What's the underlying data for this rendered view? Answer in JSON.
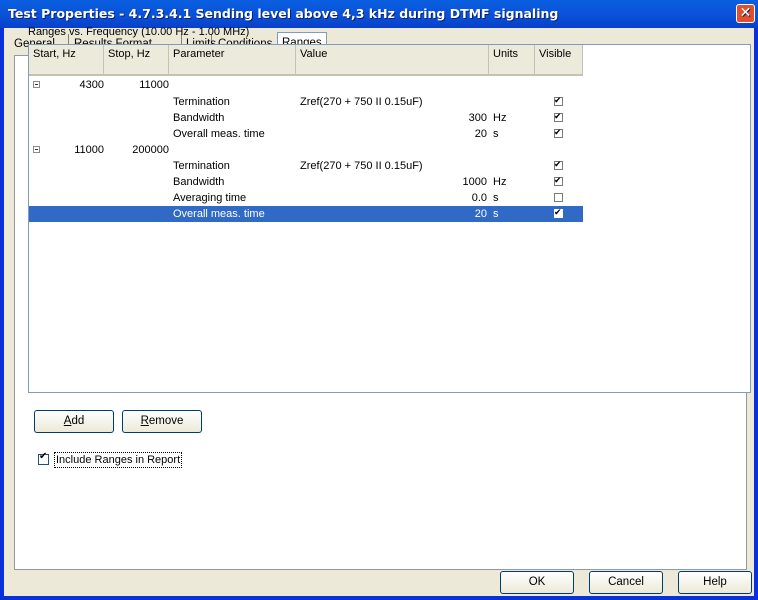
{
  "window": {
    "title": "Test Properties - 4.7.3.4.1 Sending level above 4,3 kHz during DTMF signaling",
    "close_glyph": "✕"
  },
  "tabs": [
    {
      "label": "General"
    },
    {
      "label": "Results Format"
    },
    {
      "label": "Limits"
    },
    {
      "label": "Conditions"
    },
    {
      "label": "Ranges",
      "active": true
    }
  ],
  "ranges": {
    "caption": "Ranges vs. Frequency (10.00 Hz - 1.00 MHz)",
    "columns": [
      "Start, Hz",
      "Stop, Hz",
      "Parameter",
      "Value",
      "Units",
      "Visible"
    ],
    "rows": [
      {
        "type": "group",
        "start": "4300",
        "stop": "11000"
      },
      {
        "type": "param",
        "parameter": "Termination",
        "value": "Zref(270 + 750 II 0.15uF)",
        "unit": "",
        "visible": true
      },
      {
        "type": "param",
        "parameter": "Bandwidth",
        "value": "300",
        "unit": "Hz",
        "visible": true
      },
      {
        "type": "param",
        "parameter": "Overall meas. time",
        "value": "20",
        "unit": "s",
        "visible": true
      },
      {
        "type": "group",
        "start": "11000",
        "stop": "200000"
      },
      {
        "type": "param",
        "parameter": "Termination",
        "value": "Zref(270 + 750 II 0.15uF)",
        "unit": "",
        "visible": true
      },
      {
        "type": "param",
        "parameter": "Bandwidth",
        "value": "1000",
        "unit": "Hz",
        "visible": true
      },
      {
        "type": "param",
        "parameter": "Averaging time",
        "value": "0.0",
        "unit": "s",
        "visible": false
      },
      {
        "type": "param",
        "parameter": "Overall meas. time",
        "value": "20",
        "unit": "s",
        "visible": true,
        "selected": true
      }
    ]
  },
  "buttons": {
    "add": {
      "mnemonic": "A",
      "rest": "dd"
    },
    "remove": {
      "mnemonic": "R",
      "rest": "emove"
    },
    "ok": "OK",
    "cancel": "Cancel",
    "help": "Help"
  },
  "include_in_report": {
    "label": "Include Ranges in Report",
    "checked": true
  },
  "colors": {
    "selection": "#316ac5",
    "titlebar": "#0a5fe0",
    "dialog": "#ece9d8"
  }
}
